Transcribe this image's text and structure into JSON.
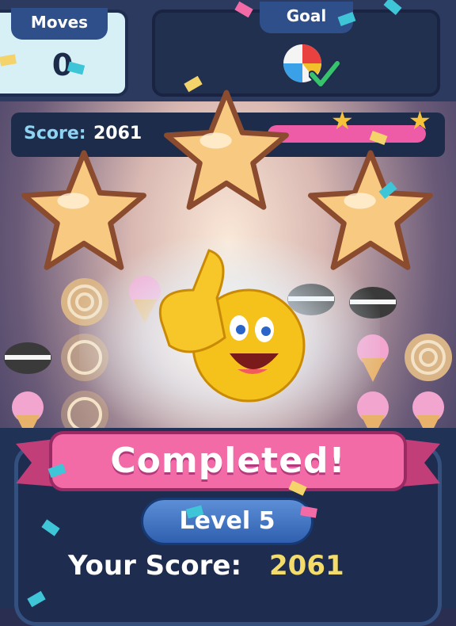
{
  "hud": {
    "moves_label": "Moves",
    "moves_value": "0",
    "goal_label": "Goal",
    "goal_item": "beach-ball-icon",
    "goal_status": "check-mark-icon"
  },
  "score_bar": {
    "label": "Score:",
    "value": "2061",
    "progress": 1.0
  },
  "board": {
    "tiles": [
      "cinnamon-roll",
      "ice-cream",
      "cookie-sandwich",
      "cinnamon-roll",
      "ice-cream"
    ]
  },
  "result": {
    "stars_earned": 3,
    "emoji": "thumbs-up-smiley-icon",
    "title": "Completed!",
    "level": "Level 5",
    "score_label": "Your Score:",
    "score_value": "2061"
  },
  "colors": {
    "ribbon": "#f26aa6",
    "score_accent": "#f4dc6a",
    "star": "#f8c980"
  }
}
